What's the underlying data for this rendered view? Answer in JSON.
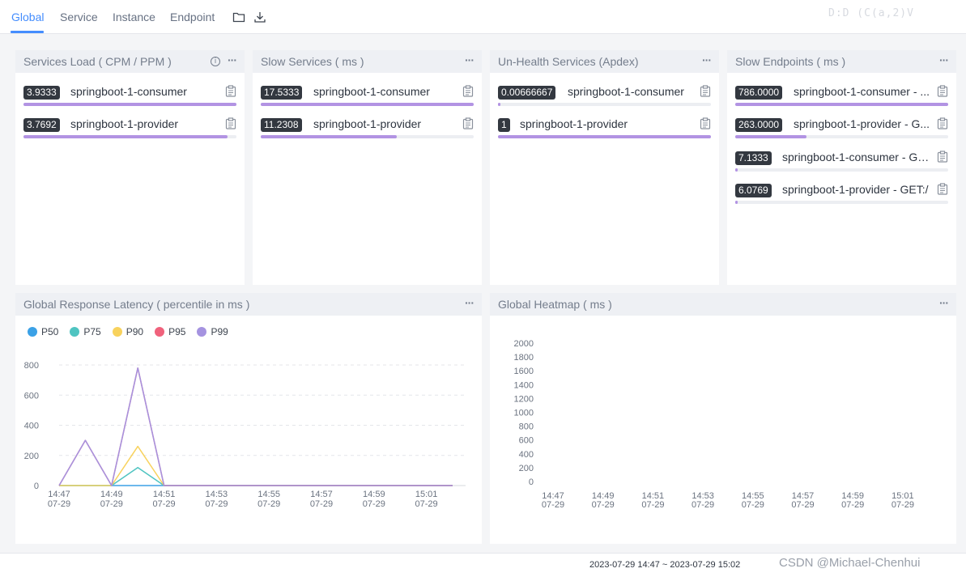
{
  "tabs": [
    "Global",
    "Service",
    "Instance",
    "Endpoint"
  ],
  "ghost_text": "D:D (C(a,2)V",
  "panels": {
    "services_load": {
      "title": "Services Load ( CPM / PPM )",
      "rows": [
        {
          "value": "3.9333",
          "label": "springboot-1-consumer",
          "fill": 1.0
        },
        {
          "value": "3.7692",
          "label": "springboot-1-provider",
          "fill": 0.96
        }
      ]
    },
    "slow_services": {
      "title": "Slow Services ( ms )",
      "rows": [
        {
          "value": "17.5333",
          "label": "springboot-1-consumer",
          "fill": 1.0
        },
        {
          "value": "11.2308",
          "label": "springboot-1-provider",
          "fill": 0.64
        }
      ]
    },
    "unhealth_services": {
      "title": "Un-Health Services (Apdex)",
      "rows": [
        {
          "value": "0.00666667",
          "label": "springboot-1-consumer",
          "fill": 0.007
        },
        {
          "value": "1",
          "label": "springboot-1-provider",
          "fill": 1.0
        }
      ]
    },
    "slow_endpoints": {
      "title": "Slow Endpoints ( ms )",
      "rows": [
        {
          "value": "786.0000",
          "label": "springboot-1-consumer - ...",
          "fill": 1.0
        },
        {
          "value": "263.0000",
          "label": "springboot-1-provider - G...",
          "fill": 0.335
        },
        {
          "value": "7.1333",
          "label": "springboot-1-consumer - GE...",
          "fill": 0.009
        },
        {
          "value": "6.0769",
          "label": "springboot-1-provider - GET:/",
          "fill": 0.008
        }
      ]
    },
    "latency": {
      "title": "Global Response Latency ( percentile in ms )"
    },
    "heatmap": {
      "title": "Global Heatmap ( ms )"
    }
  },
  "chart_data": [
    {
      "type": "line",
      "title": "Global Response Latency ( percentile in ms )",
      "x": [
        "14:47",
        "14:48",
        "14:49",
        "14:50",
        "14:51",
        "14:52",
        "14:53",
        "14:54",
        "14:55",
        "14:56",
        "14:57",
        "14:58",
        "14:59",
        "15:00",
        "15:01",
        "15:02"
      ],
      "xticks": [
        [
          "14:47",
          "07-29"
        ],
        [
          "14:49",
          "07-29"
        ],
        [
          "14:51",
          "07-29"
        ],
        [
          "14:53",
          "07-29"
        ],
        [
          "14:55",
          "07-29"
        ],
        [
          "14:57",
          "07-29"
        ],
        [
          "14:59",
          "07-29"
        ],
        [
          "15:01",
          "07-29"
        ]
      ],
      "ylim": [
        0,
        800
      ],
      "yticks": [
        0,
        200,
        400,
        600,
        800
      ],
      "grid": true,
      "legend_position": "top-left",
      "series": [
        {
          "name": "P50",
          "color": "#3ba1e6",
          "values": [
            0,
            0,
            0,
            0,
            0,
            0,
            0,
            0,
            0,
            0,
            0,
            0,
            0,
            0,
            0,
            0
          ]
        },
        {
          "name": "P75",
          "color": "#4fc4c1",
          "values": [
            0,
            0,
            0,
            120,
            0,
            0,
            0,
            0,
            0,
            0,
            0,
            0,
            0,
            0,
            0,
            0
          ]
        },
        {
          "name": "P90",
          "color": "#f8d25d",
          "values": [
            0,
            0,
            0,
            260,
            0,
            0,
            0,
            0,
            0,
            0,
            0,
            0,
            0,
            0,
            0,
            0
          ]
        },
        {
          "name": "P95",
          "color": "#f0627c",
          "values": [
            0,
            300,
            0,
            780,
            0,
            0,
            0,
            0,
            0,
            0,
            0,
            0,
            0,
            0,
            0,
            0
          ]
        },
        {
          "name": "P99",
          "color": "#a593e0",
          "values": [
            0,
            300,
            0,
            780,
            0,
            0,
            0,
            0,
            0,
            0,
            0,
            0,
            0,
            0,
            0,
            0
          ]
        }
      ]
    },
    {
      "type": "heatmap",
      "title": "Global Heatmap ( ms )",
      "xticks": [
        [
          "14:47",
          "07-29"
        ],
        [
          "14:49",
          "07-29"
        ],
        [
          "14:51",
          "07-29"
        ],
        [
          "14:53",
          "07-29"
        ],
        [
          "14:55",
          "07-29"
        ],
        [
          "14:57",
          "07-29"
        ],
        [
          "14:59",
          "07-29"
        ],
        [
          "15:01",
          "07-29"
        ]
      ],
      "ylim": [
        0,
        2000
      ],
      "yticks": [
        0,
        200,
        400,
        600,
        800,
        1000,
        1200,
        1400,
        1600,
        1800,
        2000
      ],
      "values": []
    }
  ],
  "footer": {
    "time_range": "2023-07-29 14:47 ~ 2023-07-29 15:02",
    "watermark": "CSDN @Michael-Chenhui"
  },
  "colors": {
    "accent": "#448dfe",
    "bar": "#b293e3",
    "badge": "#333840"
  }
}
